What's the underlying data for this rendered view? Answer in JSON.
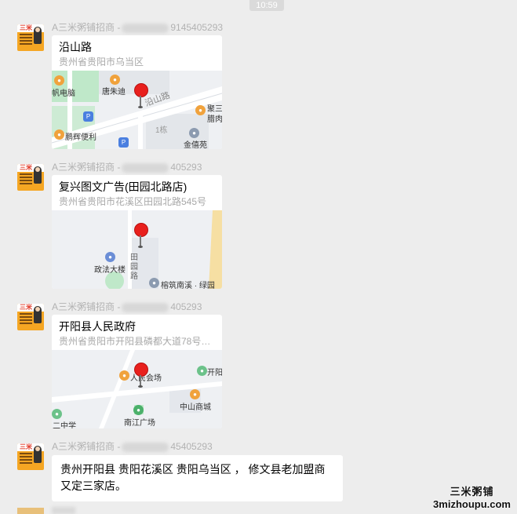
{
  "timestamp": "10:59",
  "avatar_brand": "三米",
  "messages": [
    {
      "sender_prefix": "A三米粥铺招商 -",
      "sender_suffix": "9145405293",
      "name": "沿山路",
      "address": "贵州省贵阳市乌当区",
      "map_labels": [
        "帆电脑",
        "唐朱迪",
        "沿山路",
        "聚三",
        "腊肉",
        "鹏辉便利",
        "1栋",
        "金僖苑"
      ]
    },
    {
      "sender_prefix": "A三米粥铺招商 -",
      "sender_suffix": "405293",
      "name": "复兴图文广告(田园北路店)",
      "address": "贵州省贵阳市花溪区田园北路545号",
      "map_labels": [
        "政法大楼",
        "田",
        "园",
        "路",
        "榕筑南溪 · 绿园"
      ]
    },
    {
      "sender_prefix": "A三米粥铺招商 -",
      "sender_suffix": "405293",
      "name": "开阳县人民政府",
      "address": "贵州省贵阳市开阳县磷都大道78号政...",
      "map_labels": [
        "开阳",
        "人民会场",
        "中山商城",
        "南江广场",
        "二中学"
      ]
    },
    {
      "sender_prefix": "A三米粥铺招商 -",
      "sender_suffix": "45405293",
      "text": "贵州开阳县   贵阳花溪区   贵阳乌当区  ，  修文县老加盟商又定三家店。"
    }
  ],
  "watermark": {
    "cn": "三米粥铺",
    "en": "3mizhoupu.com"
  },
  "colors": {
    "background": "#ededed",
    "bubble": "#ffffff",
    "pin": "#e8201d",
    "avatar": "#f5a623"
  }
}
